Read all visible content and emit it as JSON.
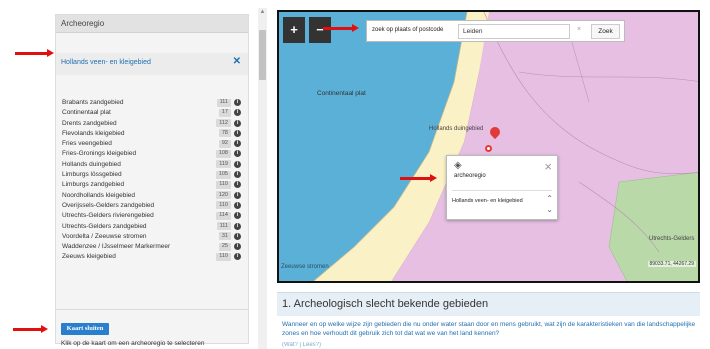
{
  "panel": {
    "title": "Archeoregio",
    "selected": "Hollands veen- en kleigebied",
    "clear_icon": "close-icon",
    "regions": [
      {
        "name": "Brabants zandgebied",
        "count": "111"
      },
      {
        "name": "Continentaal plat",
        "count": "17"
      },
      {
        "name": "Drents zandgebied",
        "count": "112"
      },
      {
        "name": "Flevolands kleigebied",
        "count": "78"
      },
      {
        "name": "Fries veengebied",
        "count": "92"
      },
      {
        "name": "Fries-Gronings kleigebied",
        "count": "108"
      },
      {
        "name": "Hollands duingebied",
        "count": "119"
      },
      {
        "name": "Limburgs lössgebied",
        "count": "105"
      },
      {
        "name": "Limburgs zandgebied",
        "count": "110"
      },
      {
        "name": "Noordhollands kleigebied",
        "count": "120"
      },
      {
        "name": "Overijssels-Gelders zandgebied",
        "count": "110"
      },
      {
        "name": "Utrechts-Gelders rivierengebied",
        "count": "114"
      },
      {
        "name": "Utrechts-Gelders zandgebied",
        "count": "111"
      },
      {
        "name": "Voordelta / Zeeuwse stromen",
        "count": "31"
      },
      {
        "name": "Waddenzee / IJsselmeer Markermeer",
        "count": "25"
      },
      {
        "name": "Zeeuws kleigebied",
        "count": "110"
      }
    ],
    "close_button": "Kaart sluiten",
    "hint": "Klik op de kaart om een archeoregio te selecteren"
  },
  "map": {
    "zoom_in": "+",
    "zoom_out": "−",
    "search_label": "zoek op plaats of postcode",
    "search_value": "Leiden",
    "search_clear": "×",
    "search_button": "Zoek",
    "labels": {
      "continental": "Continentaal plat",
      "dune": "Hollands duingebied",
      "zeeuws": "Zeeuwse stromen",
      "utrecht": "Utrechts-Gelders"
    },
    "coords": "89033.71, 44267.29",
    "colors": {
      "sea": "#5ab0d6",
      "dunes": "#fbf1c6",
      "peat": "#e6bfe3",
      "green": "#b9d9a8"
    },
    "popup": {
      "layer_icon": "layers-icon",
      "title": "archeoregio",
      "close": "×",
      "value": "Hollands veen- en kleigebied",
      "up": "⌃",
      "down": "⌄"
    }
  },
  "section": {
    "title": "1. Archeologisch slecht bekende gebieden",
    "text": "Wanneer en op welke wijze zijn gebieden die nu onder water staan door en mens gebruikt, wat zijn de karakteristieken van die landschappelijke zones en hoe verhoudt dit gebruik zich tot dat wat we van het land kennen?",
    "more": "(Wat? | Lees?)"
  },
  "colors": {
    "accent": "#2a7fcc",
    "link": "#1f6fb2",
    "annotation": "#e01010"
  }
}
